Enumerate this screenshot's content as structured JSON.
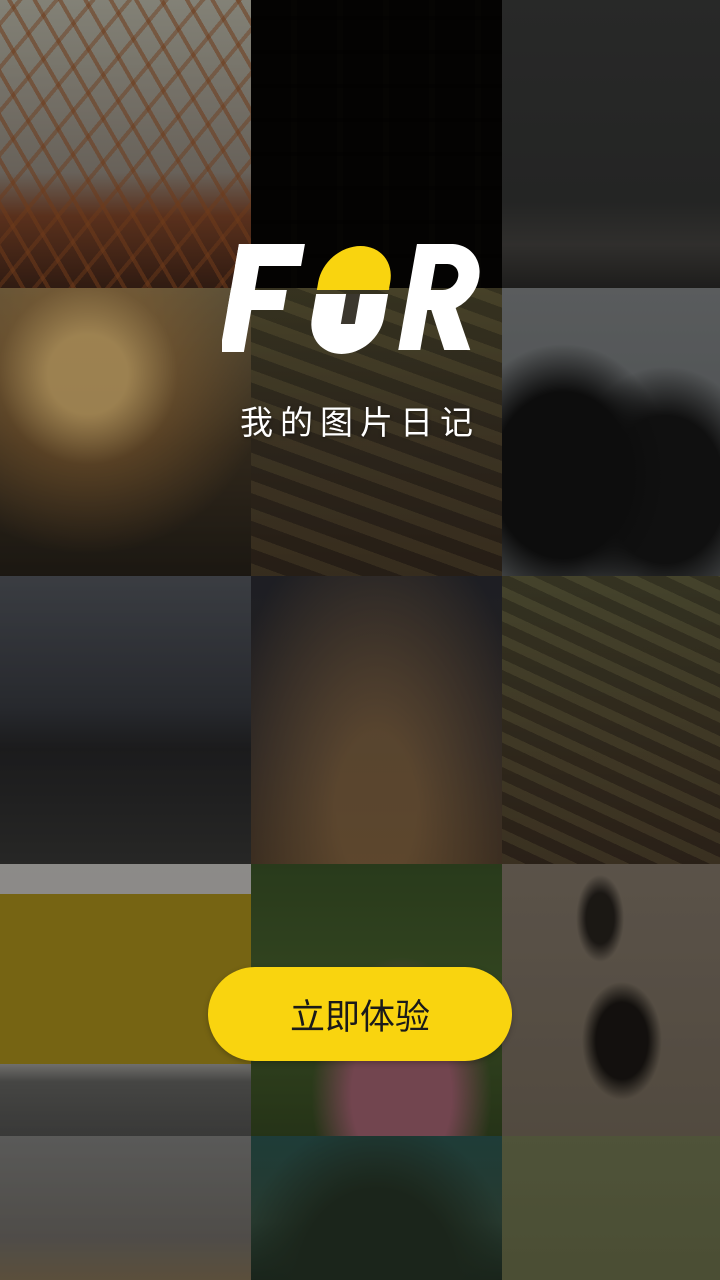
{
  "app": {
    "logo_text": "FOR",
    "brand_accent": "#F9D40F",
    "tagline": "我的图片日记"
  },
  "action": {
    "start_label": "立即体验"
  },
  "background_grid": {
    "tiles": [
      "bridge-arch-photo",
      "building-facade-photo",
      "foggy-pier-photo",
      "girl-sunset-photo",
      "mossy-log-photo",
      "two-girls-photo",
      "car-woman-photo",
      "foggy-railway-photo",
      "mossy-log-closeup-photo",
      "classic-cars-photo",
      "child-grass-photo",
      "footprints-sand-photo",
      "coastal-cliff-photo",
      "forest-lake-photo",
      "olive-blank-photo"
    ]
  }
}
